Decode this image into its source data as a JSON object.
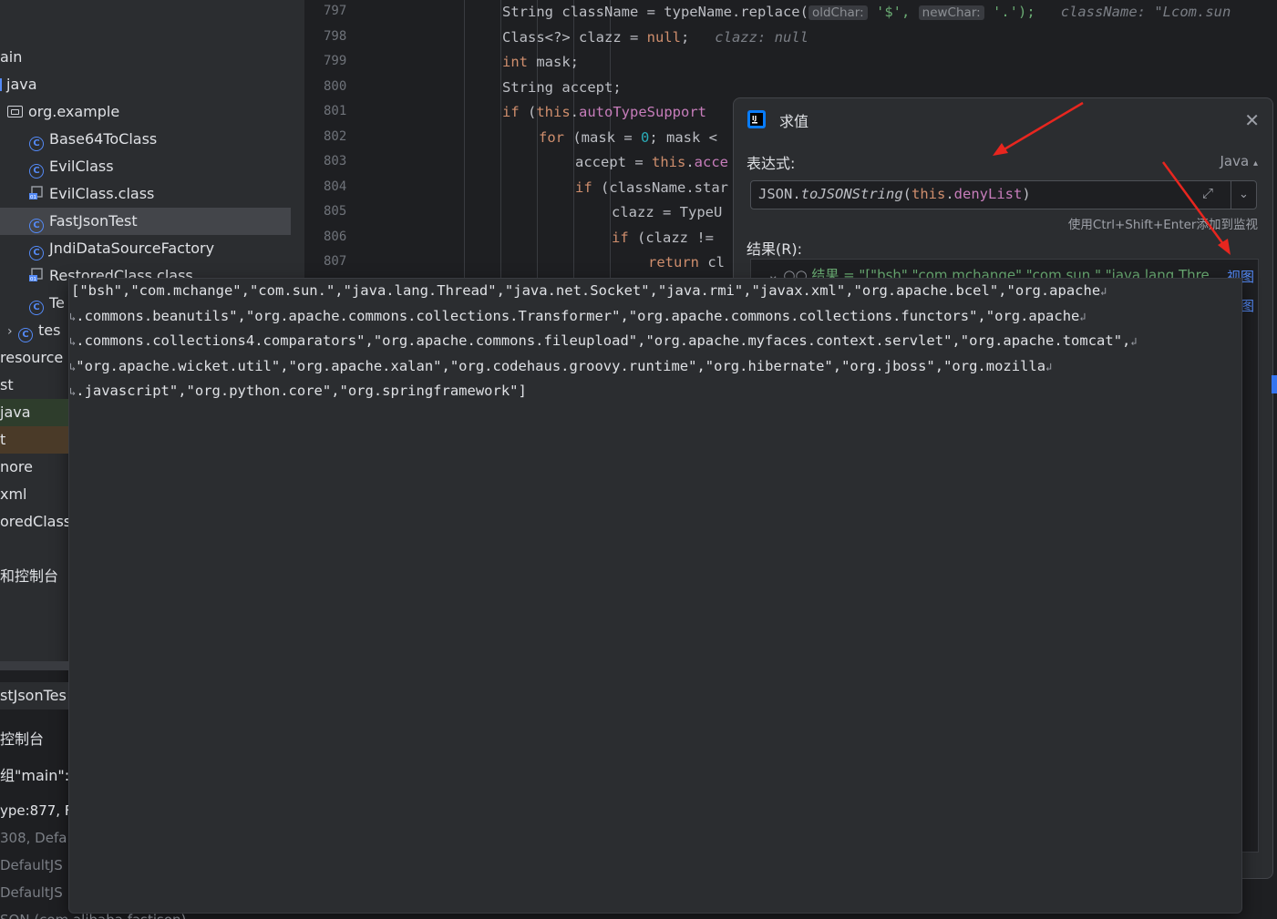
{
  "project_tree": {
    "items": [
      {
        "label": "ain",
        "kind": "text"
      },
      {
        "label": "java",
        "kind": "folder-src"
      },
      {
        "label": "org.example",
        "kind": "package"
      },
      {
        "label": "Base64ToClass",
        "kind": "class"
      },
      {
        "label": "EvilClass",
        "kind": "class"
      },
      {
        "label": "EvilClass.class",
        "kind": "classfile"
      },
      {
        "label": "FastJsonTest",
        "kind": "class",
        "selected": true
      },
      {
        "label": "JndiDataSourceFactory",
        "kind": "class"
      },
      {
        "label": "RestoredClass.class",
        "kind": "classfile"
      },
      {
        "label": "Te",
        "kind": "class"
      },
      {
        "label": "tes",
        "kind": "class"
      }
    ]
  },
  "left_strip": {
    "rows": [
      "resource",
      "st",
      "java",
      "t",
      "nore",
      "xml",
      "oredClass.",
      "和控制台",
      "stJsonTes",
      "控制台",
      "组\"main\":",
      "ype:877, F",
      "308, Defa",
      "DefaultJS",
      "DefaultJS",
      "SON (com.alibaba.fastjson)"
    ]
  },
  "editor": {
    "line_numbers": [
      "797",
      "798",
      "799",
      "800",
      "801",
      "802",
      "803",
      "804",
      "805",
      "806",
      "807"
    ],
    "lines": [
      {
        "indent": 0,
        "parts": [
          [
            "String className = typeName.replace(",
            ""
          ],
          [
            "oldChar:",
            "inlay"
          ],
          [
            " '$', ",
            "str"
          ],
          [
            "newChar:",
            "inlay"
          ],
          [
            " '.');   ",
            "str"
          ],
          [
            "className: \"Lcom.sun",
            "hint"
          ]
        ]
      },
      {
        "indent": 0,
        "parts": [
          [
            "Class<?> clazz = ",
            ""
          ],
          [
            "null",
            "kw"
          ],
          [
            ";   ",
            ""
          ],
          [
            "clazz: null",
            "hint"
          ]
        ]
      },
      {
        "indent": 0,
        "parts": [
          [
            "int",
            "kw"
          ],
          [
            " mask;",
            ""
          ]
        ]
      },
      {
        "indent": 0,
        "parts": [
          [
            "String accept;",
            ""
          ]
        ]
      },
      {
        "indent": 0,
        "parts": [
          [
            "if",
            "kw"
          ],
          [
            " (",
            ""
          ],
          [
            "this",
            "kw"
          ],
          [
            ".",
            ""
          ],
          [
            "autoTypeSupport",
            "fld"
          ]
        ]
      },
      {
        "indent": 1,
        "parts": [
          [
            "for",
            "kw"
          ],
          [
            " (mask = ",
            ""
          ],
          [
            "0",
            "num"
          ],
          [
            "; mask <",
            ""
          ]
        ]
      },
      {
        "indent": 2,
        "parts": [
          [
            "accept = ",
            ""
          ],
          [
            "this",
            "kw"
          ],
          [
            ".",
            ""
          ],
          [
            "acce",
            "fld"
          ]
        ]
      },
      {
        "indent": 2,
        "parts": [
          [
            "if",
            "kw"
          ],
          [
            " (className.star",
            ""
          ]
        ]
      },
      {
        "indent": 3,
        "parts": [
          [
            "clazz = TypeU",
            ""
          ]
        ]
      },
      {
        "indent": 3,
        "parts": [
          [
            "if",
            "kw"
          ],
          [
            " (clazz != ",
            ""
          ]
        ]
      },
      {
        "indent": 4,
        "parts": [
          [
            "return",
            "kw"
          ],
          [
            " cl",
            ""
          ]
        ]
      }
    ]
  },
  "evaluate_dialog": {
    "title": "求值",
    "expression_label": "表达式:",
    "language": "Java",
    "expression_parts": [
      [
        "JSON.",
        ""
      ],
      [
        "toJSONString",
        "italic"
      ],
      [
        "(",
        ""
      ],
      [
        "this",
        "kw"
      ],
      [
        ".",
        ""
      ],
      [
        "denyList",
        "fld"
      ],
      [
        ")",
        ""
      ]
    ],
    "hint": "使用Ctrl+Shift+Enter添加到监视",
    "result_label": "结果(R):",
    "result_row": "结果 = \"[\"bsh\",\"com.mchange\",\"com.sun.\",\"java.lang.Thre",
    "view_link": "视图",
    "view_link2": "图"
  },
  "value_popup": {
    "lines": [
      "[\"bsh\",\"com.mchange\",\"com.sun.\",\"java.lang.Thread\",\"java.net.Socket\",\"java.rmi\",\"javax.xml\",\"org.apache.bcel\",\"org.apache",
      ".commons.beanutils\",\"org.apache.commons.collections.Transformer\",\"org.apache.commons.collections.functors\",\"org.apache",
      ".commons.collections4.comparators\",\"org.apache.commons.fileupload\",\"org.apache.myfaces.context.servlet\",\"org.apache.tomcat\",",
      "\"org.apache.wicket.util\",\"org.apache.xalan\",\"org.codehaus.groovy.runtime\",\"org.hibernate\",\"org.jboss\",\"org.mozilla",
      ".javascript\",\"org.python.core\",\"org.springframework\"]"
    ]
  },
  "colors": {
    "arrow": "#e8261f",
    "accent": "#548af7"
  }
}
